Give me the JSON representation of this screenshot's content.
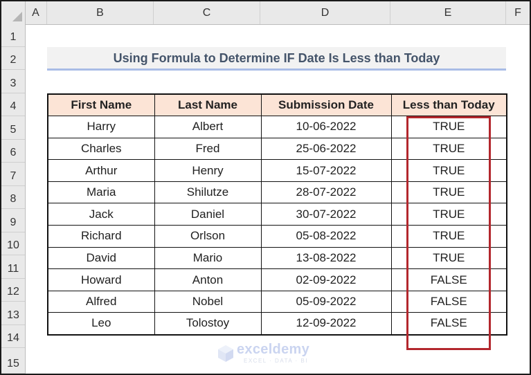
{
  "spreadsheet": {
    "column_headers": [
      "A",
      "B",
      "C",
      "D",
      "E",
      "F"
    ],
    "row_headers": [
      "1",
      "2",
      "3",
      "4",
      "5",
      "6",
      "7",
      "8",
      "9",
      "10",
      "11",
      "12",
      "13",
      "14",
      "15"
    ],
    "title": "Using Formula to Determine IF Date Is Less than Today",
    "table": {
      "headers": [
        "First Name",
        "Last Name",
        "Submission Date",
        "Less than Today"
      ],
      "rows": [
        [
          "Harry",
          "Albert",
          "10-06-2022",
          "TRUE"
        ],
        [
          "Charles",
          "Fred",
          "25-06-2022",
          "TRUE"
        ],
        [
          "Arthur",
          "Henry",
          "15-07-2022",
          "TRUE"
        ],
        [
          "Maria",
          "Shilutze",
          "28-07-2022",
          "TRUE"
        ],
        [
          "Jack",
          "Daniel",
          "30-07-2022",
          "TRUE"
        ],
        [
          "Richard",
          "Orlson",
          "05-08-2022",
          "TRUE"
        ],
        [
          "David",
          "Mario",
          "13-08-2022",
          "TRUE"
        ],
        [
          "Howard",
          "Anton",
          "02-09-2022",
          "FALSE"
        ],
        [
          "Alfred",
          "Nobel",
          "05-09-2022",
          "FALSE"
        ],
        [
          "Leo",
          "Tolostoy",
          "12-09-2022",
          "FALSE"
        ]
      ]
    },
    "highlight_color": "#b3272d",
    "header_fill": "#fce4d6",
    "title_color": "#44546a"
  },
  "watermark": {
    "name": "exceldemy",
    "tagline": "EXCEL · DATA · BI"
  }
}
